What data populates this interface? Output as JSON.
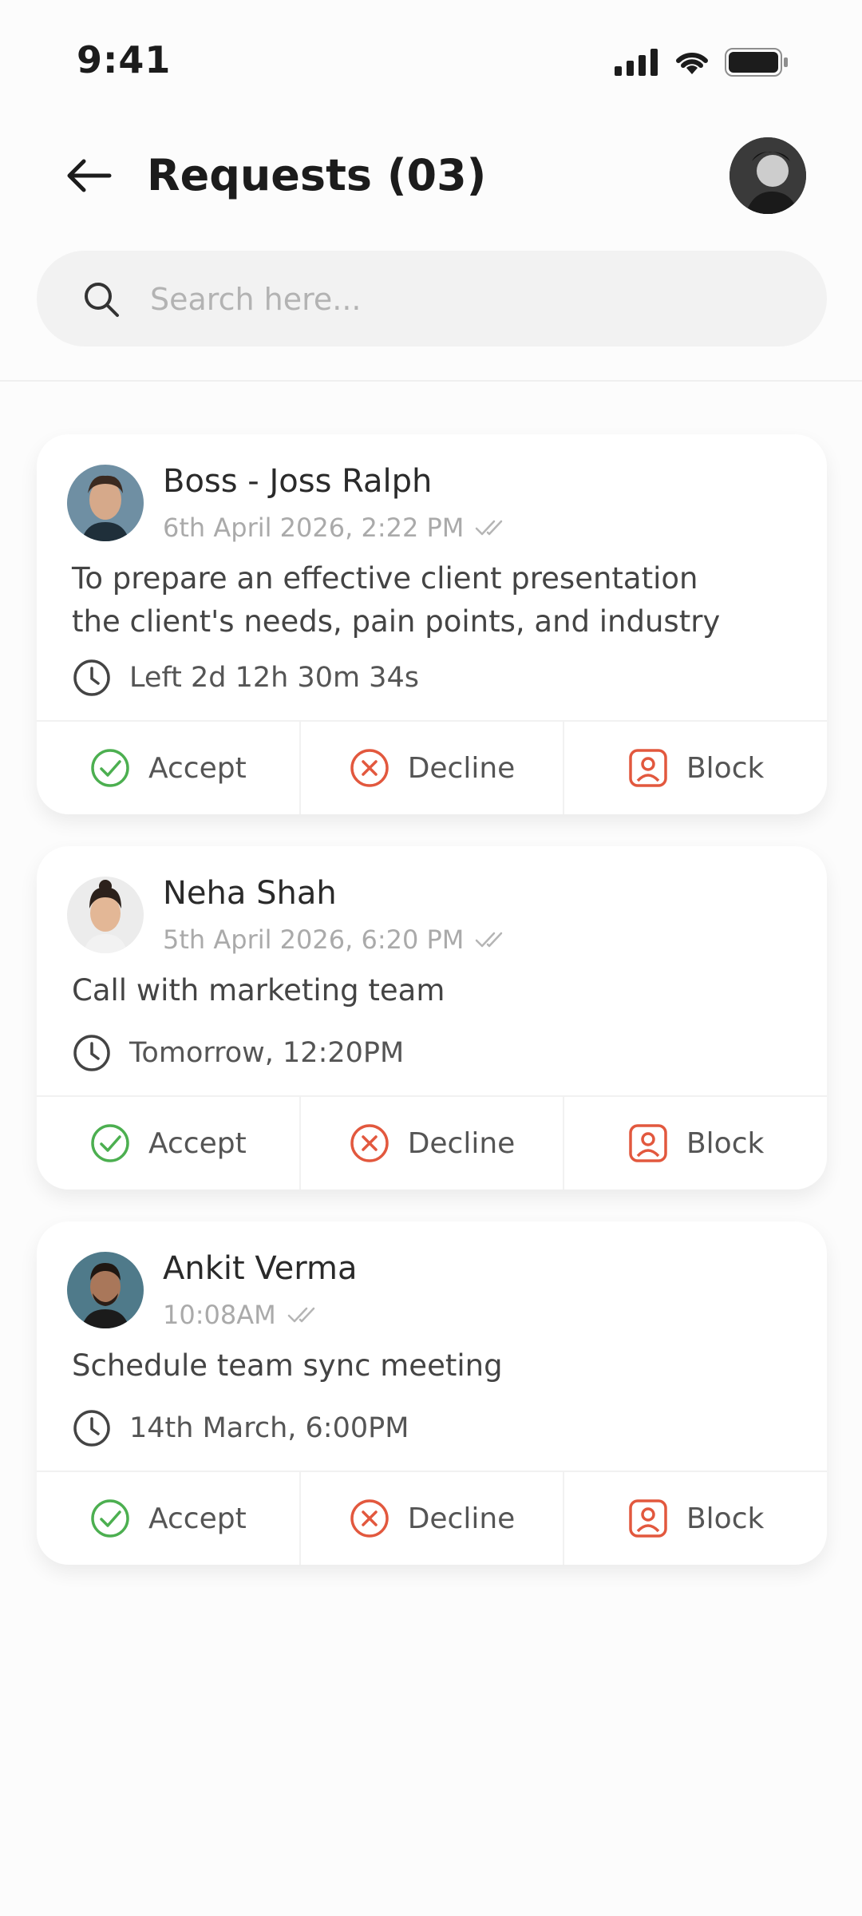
{
  "status": {
    "time": "9:41"
  },
  "header": {
    "title": "Requests (03)"
  },
  "search": {
    "placeholder": "Search here..."
  },
  "colors": {
    "accept": "#4caf50",
    "decline": "#e2583e",
    "block": "#e2583e",
    "muted": "#aaaaaa"
  },
  "requests": [
    {
      "name": "Boss - Joss Ralph",
      "timestamp": "6th April 2026, 2:22 PM",
      "message_line1": "To prepare an effective client presentation",
      "message_line2": "the client's needs, pain points, and industry",
      "due": "Left 2d 12h 30m 34s",
      "accept": "Accept",
      "decline": "Decline",
      "block": "Block"
    },
    {
      "name": "Neha Shah",
      "timestamp": "5th April 2026, 6:20 PM",
      "message_line1": "Call with marketing team",
      "due": "Tomorrow, 12:20PM",
      "accept": "Accept",
      "decline": "Decline",
      "block": "Block"
    },
    {
      "name": "Ankit Verma",
      "timestamp": "10:08AM",
      "message_line1": "Schedule team sync meeting",
      "due": "14th March, 6:00PM",
      "accept": "Accept",
      "decline": "Decline",
      "block": "Block"
    }
  ]
}
